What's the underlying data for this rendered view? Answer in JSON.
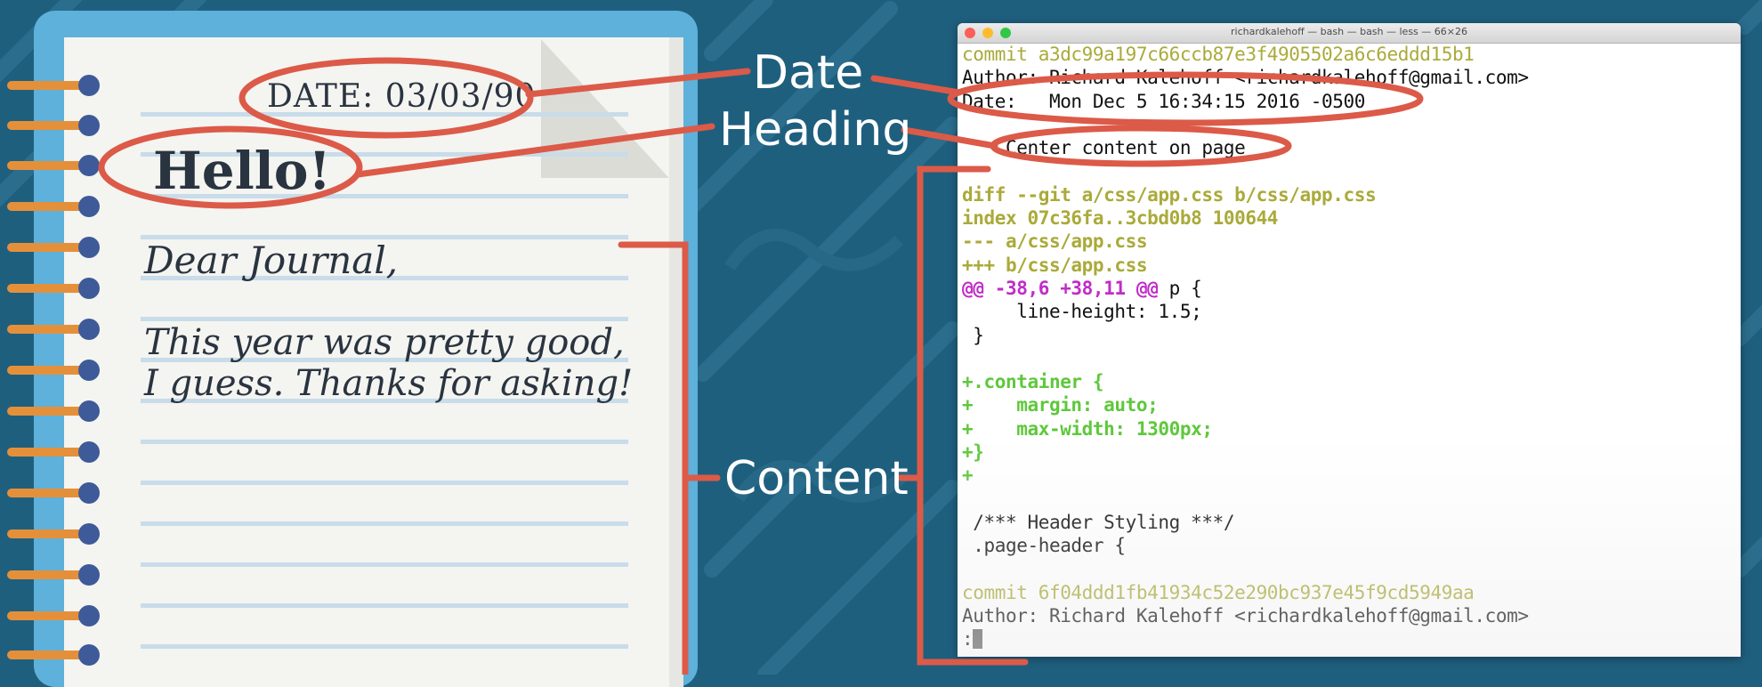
{
  "notebook": {
    "date_text": "DATE: 03/03/90",
    "heading_text": "Hello!",
    "greeting_text": "Dear Journal,",
    "body_line_1": "This year was pretty good,",
    "body_line_2": "I guess. Thanks for asking!"
  },
  "callouts": {
    "date_label": "Date",
    "heading_label": "Heading",
    "content_label": "Content"
  },
  "terminal": {
    "title": "richardkalehoff — bash — bash — less — 66×26",
    "lines": [
      {
        "text": "commit a3dc99a197c66ccb87e3f4905502a6c6eddd15b1",
        "style": "commit"
      },
      {
        "text": "Author: Richard Kalehoff <richardkalehoff@gmail.com>",
        "style": "plain"
      },
      {
        "text": "Date:   Mon Dec 5 16:34:15 2016 -0500",
        "style": "plain"
      },
      {
        "text": "",
        "style": "plain"
      },
      {
        "text": "    Center content on page",
        "style": "plain"
      },
      {
        "text": "",
        "style": "plain"
      },
      {
        "text": "diff --git a/css/app.css b/css/app.css",
        "style": "diff"
      },
      {
        "text": "index 07c36fa..3cbd0b8 100644",
        "style": "diff"
      },
      {
        "text": "--- a/css/app.css",
        "style": "diff"
      },
      {
        "text": "+++ b/css/app.css",
        "style": "diff"
      },
      {
        "text": "@@ -38,6 +38,11 @@",
        "tail": " p {",
        "style": "hunk"
      },
      {
        "text": "     line-height: 1.5;",
        "style": "plain"
      },
      {
        "text": " }",
        "style": "plain"
      },
      {
        "text": "",
        "style": "plain"
      },
      {
        "text": "+.container {",
        "style": "add"
      },
      {
        "text": "+    margin: auto;",
        "style": "add"
      },
      {
        "text": "+    max-width: 1300px;",
        "style": "add"
      },
      {
        "text": "+}",
        "style": "add"
      },
      {
        "text": "+",
        "style": "add"
      },
      {
        "text": "",
        "style": "plain"
      },
      {
        "text": " /*** Header Styling ***/",
        "style": "plain"
      },
      {
        "text": " .page-header {",
        "style": "plain"
      },
      {
        "text": "",
        "style": "plain"
      },
      {
        "text": "commit 6f04ddd1fb41934c52e290bc937e45f9cd5949aa",
        "style": "commit"
      },
      {
        "text": "Author: Richard Kalehoff <richardkalehoff@gmail.com>",
        "style": "plain"
      },
      {
        "text": ":",
        "style": "prompt"
      }
    ]
  },
  "colors": {
    "background": "#1f5f7e",
    "annotation": "#dc5a48",
    "commit_text": "#aaaa3a",
    "hunk_text": "#c02cc8",
    "added_text": "#5fc83c",
    "notebook_cover": "#5db1db"
  }
}
